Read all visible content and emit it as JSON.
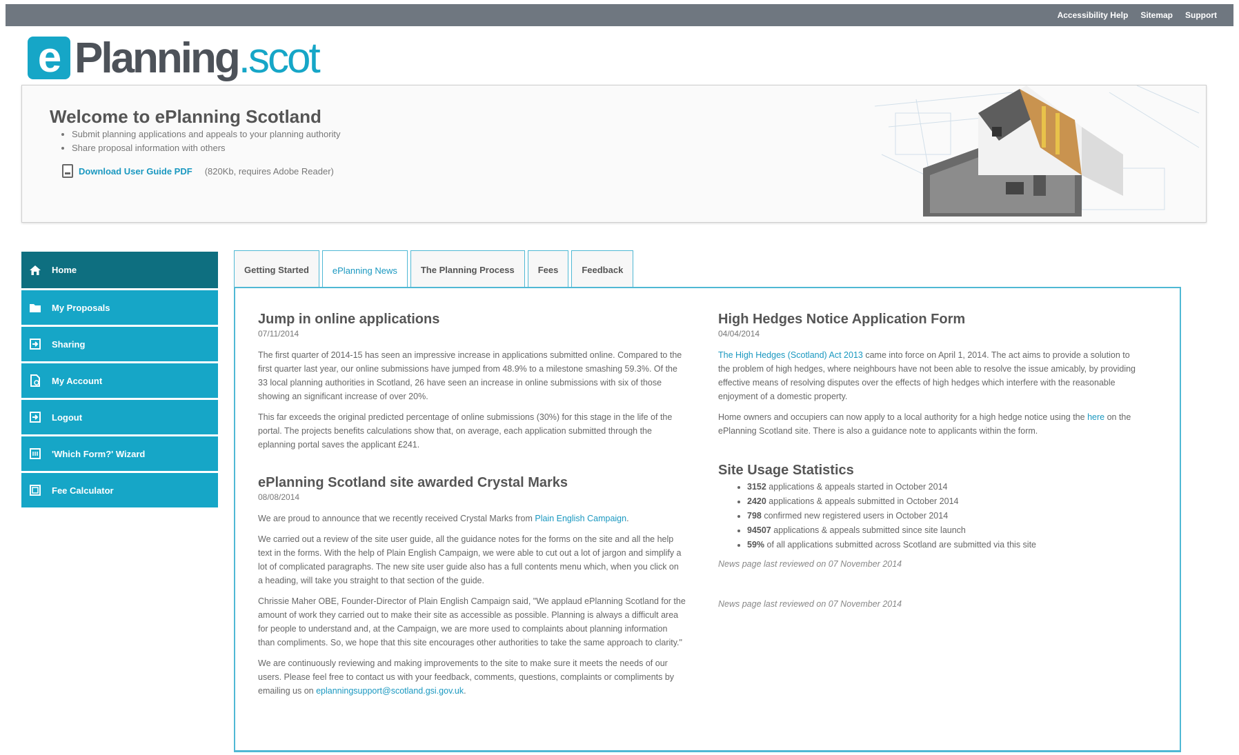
{
  "top_links": [
    "Accessibility Help",
    "Sitemap",
    "Support"
  ],
  "logo": {
    "letter": "e",
    "main": "Planning",
    "suffix": ".scot"
  },
  "welcome": {
    "title": "Welcome to ePlanning Scotland",
    "bullets": [
      "Submit planning applications and appeals to your planning authority",
      "Share proposal information with others"
    ],
    "guide_link": "Download User Guide PDF",
    "guide_note": "(820Kb, requires Adobe Reader)"
  },
  "sidebar": {
    "items": [
      {
        "label": "Home",
        "icon": "home-icon"
      },
      {
        "label": "My Proposals",
        "icon": "folder-icon"
      },
      {
        "label": "Sharing",
        "icon": "share-icon"
      },
      {
        "label": "My Account",
        "icon": "account-icon"
      },
      {
        "label": "Logout",
        "icon": "logout-icon"
      },
      {
        "label": "'Which Form?' Wizard",
        "icon": "wizard-icon"
      },
      {
        "label": "Fee Calculator",
        "icon": "calculator-icon"
      }
    ]
  },
  "tabs": [
    "Getting Started",
    "ePlanning News",
    "The Planning Process",
    "Fees",
    "Feedback"
  ],
  "news": {
    "a1": {
      "title": "Jump in online applications",
      "date": "07/11/2014",
      "p1": "The first quarter of 2014-15 has seen an impressive increase in applications submitted online. Compared to the first quarter last year, our online submissions have jumped from 48.9% to a milestone smashing 59.3%. Of the 33 local planning authorities in Scotland, 26 have seen an increase in online submissions with six of those showing an significant increase of over 20%.",
      "p2": "This far exceeds the original predicted percentage of online submissions (30%) for this stage in the life of the portal. The projects benefits calculations show that, on average, each application submitted through the eplanning portal saves the applicant £241."
    },
    "a2": {
      "title": "ePlanning Scotland site awarded Crystal Marks",
      "date": "08/08/2014",
      "p1_pre": "We are proud to announce that we recently received Crystal Marks from",
      "p1_link": "Plain English Campaign",
      "p1_post": ".",
      "p2": "We carried out a review of the site user guide, all the guidance notes for the forms on the site and all the help text in the forms. With the help of Plain English Campaign, we were able to cut out a lot of jargon and simplify a lot of complicated paragraphs. The new site user guide also has a full contents menu which, when you click on a heading, will take you straight to that section of the guide.",
      "p3": "Chrissie Maher OBE, Founder-Director of Plain English Campaign said, \"We applaud ePlanning Scotland for the amount of work they carried out to make their site as accessible as possible. Planning is always a difficult area for people to understand and, at the Campaign, we are more used to complaints about planning information than compliments. So, we hope that this site encourages other authorities to take the same approach to clarity.\"",
      "p4_pre": "We are continuously reviewing and making improvements to the site to make sure it meets the needs of our users. Please feel free to contact us with your feedback, comments, questions, complaints or compliments by emailing us on",
      "p4_link": "eplanningsupport@scotland.gsi.gov.uk",
      "p4_post": "."
    },
    "a3": {
      "title": "High Hedges Notice Application Form",
      "date": "04/04/2014",
      "p1_link": "The High Hedges (Scotland) Act 2013",
      "p1_post": "came into force on April 1, 2014. The act aims to provide a solution to the problem of high hedges, where neighbours have not been able to resolve the issue amicably, by providing effective means of resolving disputes over the effects of high hedges which interfere with the reasonable enjoyment of a domestic property.",
      "p2_pre": "Home owners and occupiers can now apply to a local authority for a high hedge notice using the",
      "p2_link": "here",
      "p2_post": "on the ePlanning Scotland site. There is also a guidance note to applicants within the form."
    },
    "stats": {
      "title": "Site Usage Statistics",
      "items": [
        {
          "value": "3152",
          "text": "applications & appeals started in October 2014"
        },
        {
          "value": "2420",
          "text": "applications & appeals submitted in October 2014"
        },
        {
          "value": "798",
          "text": "confirmed new registered users in October 2014"
        },
        {
          "value": "94507",
          "text": "applications & appeals submitted since site launch"
        },
        {
          "value": "59%",
          "text": "of all applications submitted across Scotland are submitted via this site"
        }
      ],
      "reviewed1": "News page last reviewed on 07 November 2014",
      "reviewed2": "News page last reviewed on 07 November 2014"
    }
  }
}
